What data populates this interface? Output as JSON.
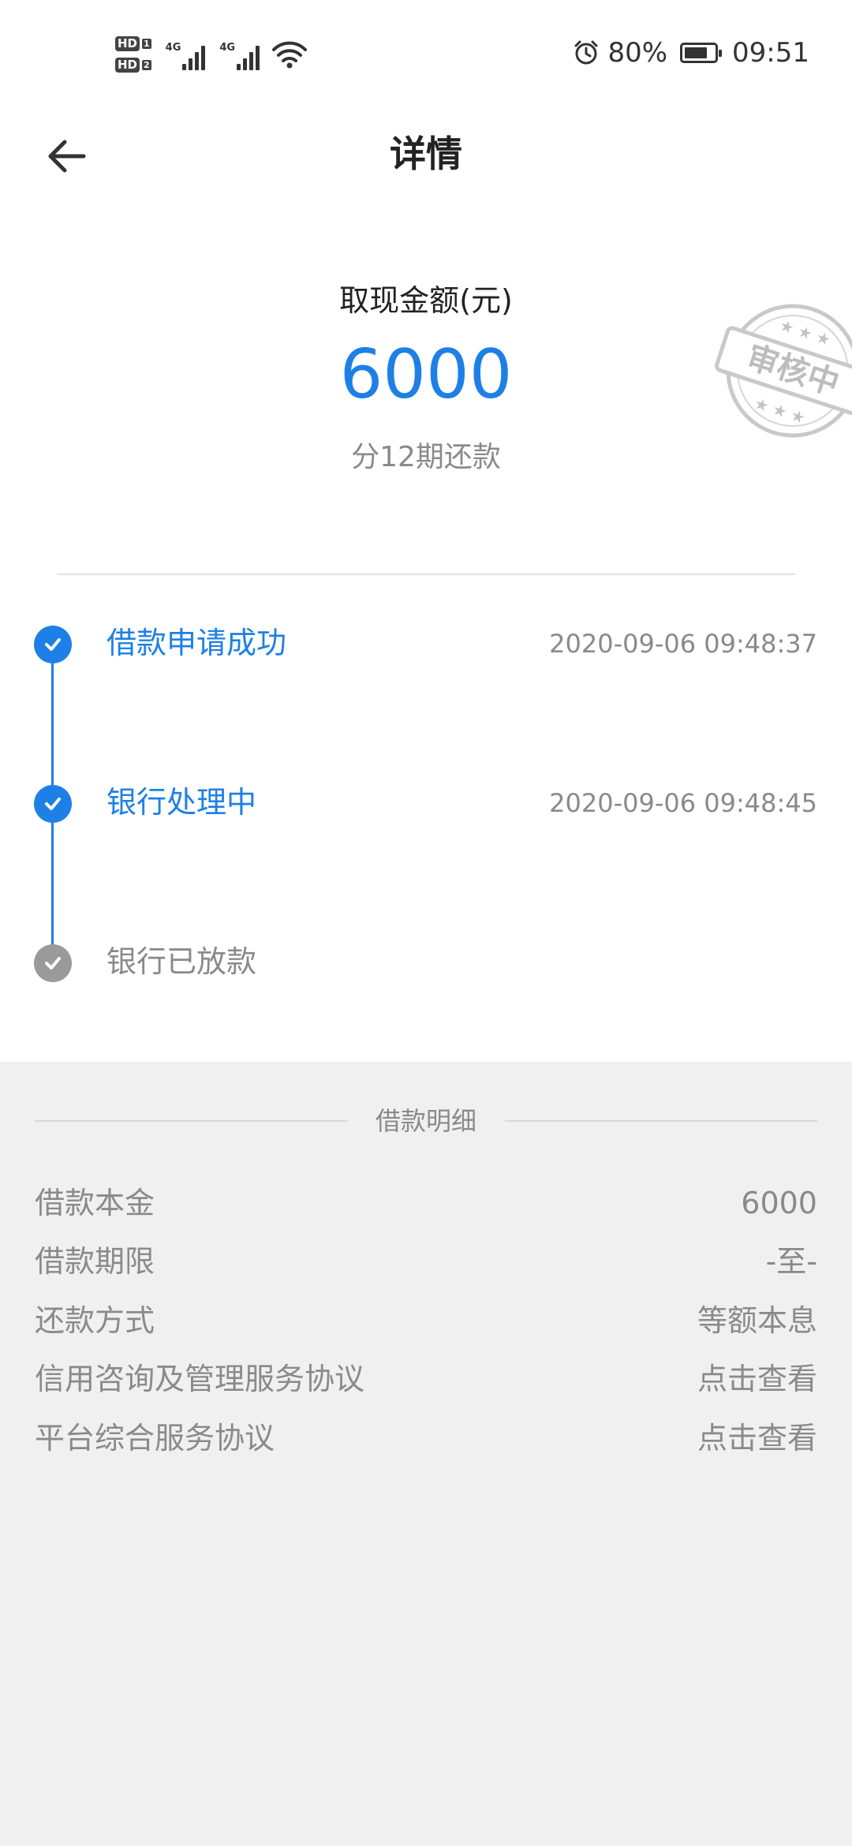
{
  "status_bar": {
    "hd1": "HD",
    "hd1_sub": "1",
    "hd2": "HD",
    "hd2_sub": "2",
    "network1": "4G",
    "network2": "4G",
    "battery_percent": "80%",
    "battery_level": 0.8,
    "time": "09:51"
  },
  "header": {
    "title": "详情"
  },
  "amount": {
    "label": "取现金额(元)",
    "value": "6000",
    "installment": "分12期还款",
    "stamp_text": "审核中"
  },
  "timeline": [
    {
      "label": "借款申请成功",
      "time": "2020-09-06 09:48:37",
      "state": "done"
    },
    {
      "label": "银行处理中",
      "time": "2020-09-06 09:48:45",
      "state": "done"
    },
    {
      "label": "银行已放款",
      "time": "",
      "state": "pending"
    }
  ],
  "details": {
    "section_title": "借款明细",
    "rows": [
      {
        "label": "借款本金",
        "value": "6000"
      },
      {
        "label": "借款期限",
        "value": "-至-"
      },
      {
        "label": "还款方式",
        "value": "等额本息"
      },
      {
        "label": "信用咨询及管理服务协议",
        "value": "点击查看"
      },
      {
        "label": "平台综合服务协议",
        "value": "点击查看"
      }
    ]
  },
  "colors": {
    "accent": "#1e80e6",
    "muted": "#8a8a8a",
    "section_bg": "#f0f0f0"
  }
}
